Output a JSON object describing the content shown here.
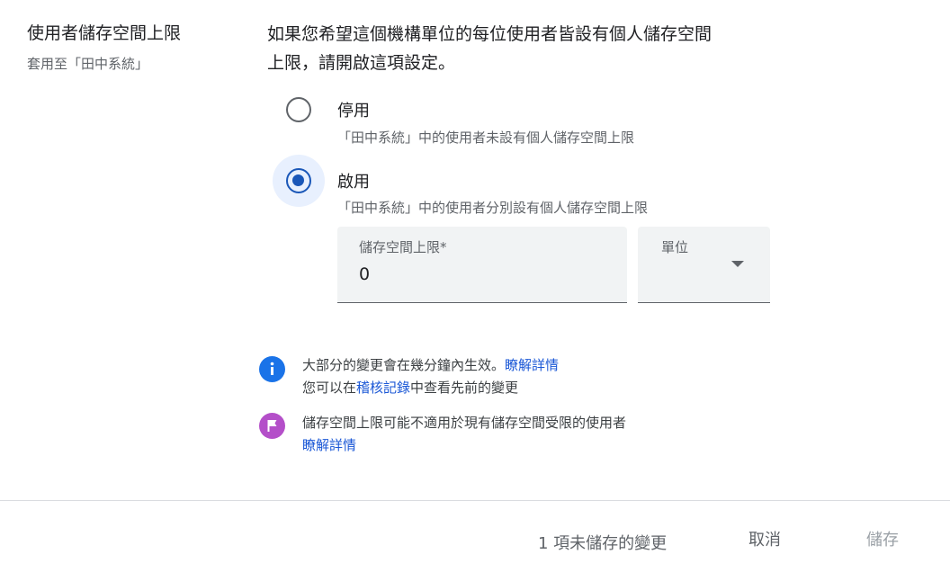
{
  "setting": {
    "title": "使用者儲存空間上限",
    "applies_to": "套用至「田中系統」"
  },
  "description": {
    "line1": "如果您希望這個機構單位的每位使用者皆設有個人儲存空間",
    "line2": "上限，請開啟這項設定。"
  },
  "options": [
    {
      "label": "停用",
      "help": "「田中系統」中的使用者未設有個人儲存空間上限",
      "selected": false
    },
    {
      "label": "啟用",
      "help": "「田中系統」中的使用者分別設有個人儲存空間上限",
      "selected": true
    }
  ],
  "fields": {
    "limit": {
      "label": "儲存空間上限*",
      "value": "0"
    },
    "unit": {
      "label": "單位",
      "value": ""
    }
  },
  "notes": {
    "info": {
      "text1": "大部分的變更會在幾分鐘內生效。",
      "link1": "瞭解詳情",
      "text2a": "您可以在",
      "link2": "稽核記錄",
      "text2b": "中查看先前的變更"
    },
    "flag": {
      "text": "儲存空間上限可能不適用於現有儲存空間受限的使用者",
      "link": "瞭解詳情"
    }
  },
  "footer": {
    "unsaved": "1 項未儲存的變更",
    "cancel": "取消",
    "save": "儲存"
  },
  "colors": {
    "accent": "#1a57b8",
    "info_icon": "#1a73e8",
    "flag_icon": "#b44fc9",
    "link": "#1a57d6"
  }
}
